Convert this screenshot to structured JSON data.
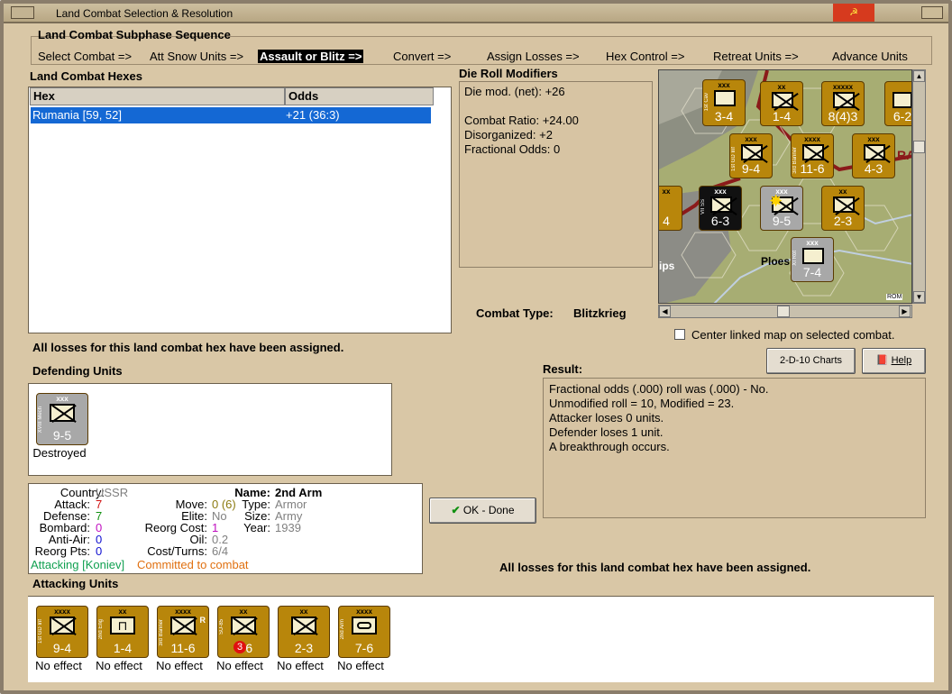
{
  "window": {
    "title": "Land Combat Selection & Resolution"
  },
  "sequence": {
    "heading": "Land Combat Subphase Sequence",
    "steps": [
      "Select Combat =>",
      "Att Snow Units =>",
      "Assault or Blitz =>",
      "Convert =>",
      "Assign Losses =>",
      "Hex Control =>",
      "Retreat Units =>",
      "Advance Units"
    ],
    "active_index": 2
  },
  "hexes": {
    "heading": "Land Combat Hexes",
    "columns": [
      "Hex",
      "Odds"
    ],
    "rows": [
      {
        "hex": "Rumania [59, 52]",
        "odds": "+21 (36:3)"
      }
    ]
  },
  "die_roll": {
    "heading": "Die Roll Modifiers",
    "lines": [
      "Die mod. (net): +26",
      "",
      "Combat Ratio: +24.00",
      "Disorganized: +2",
      "Fractional Odds: 0"
    ]
  },
  "combat_type": {
    "label": "Combat Type:",
    "value": "Blitzkrieg"
  },
  "center_map": {
    "label": "Center linked map on selected combat.",
    "checked": false
  },
  "buttons": {
    "charts": "2-D-10 Charts",
    "help": "Help",
    "ok": "OK - Done"
  },
  "losses_msg": "All losses for this land combat hex have been assigned.",
  "defending": {
    "heading": "Defending Units",
    "units": [
      {
        "size": "xxx",
        "side": "XVIII Mech",
        "value": "9-5",
        "status": "Destroyed",
        "color": "grey"
      }
    ]
  },
  "info": {
    "country_label": "Country:",
    "country": "USSR",
    "attack_label": "Attack:",
    "attack": "7",
    "defense_label": "Defense:",
    "defense": "7",
    "bombard_label": "Bombard:",
    "bombard": "0",
    "antiair_label": "Anti-Air:",
    "antiair": "0",
    "reorgpts_label": "Reorg Pts:",
    "reorgpts": "0",
    "name_label": "Name:",
    "name": "2nd Arm",
    "move_label": "Move:",
    "move": "0 (6)",
    "type_label": "Type:",
    "type": "Armor",
    "elite_label": "Elite:",
    "elite": "No",
    "size_label": "Size:",
    "size": "Army",
    "reorgcost_label": "Reorg Cost:",
    "reorgcost": "1",
    "year_label": "Year:",
    "year": "1939",
    "oil_label": "Oil:",
    "oil": "0.2",
    "costturns_label": "Cost/Turns:",
    "costturns": "6/4",
    "attacking": "Attacking [Koniev]",
    "committed": "Committed to combat"
  },
  "result": {
    "heading": "Result:",
    "lines": [
      "Fractional odds (.000) roll was (.000)  - No.",
      "Unmodified roll = 10, Modified = 23.",
      "Attacker loses 0 units.",
      "Defender loses 1 unit.",
      "A breakthrough occurs."
    ]
  },
  "attacking": {
    "heading": "Attacking Units",
    "units": [
      {
        "size": "xxxx",
        "side": "1st GD Inf",
        "value": "9-4",
        "status": "No effect",
        "symbol": "inf"
      },
      {
        "size": "xx",
        "side": "2nd Eng",
        "value": "1-4",
        "status": "No effect",
        "symbol": "eng"
      },
      {
        "size": "xxxx",
        "side": "3rd Banner",
        "value": "11-6",
        "status": "No effect",
        "symbol": "inf",
        "r": "R"
      },
      {
        "size": "xx",
        "side": "SU-85",
        "value": "3-6",
        "status": "No effect",
        "symbol": "mech",
        "badge": "3"
      },
      {
        "size": "xx",
        "side": "",
        "value": "2-3",
        "status": "No effect",
        "symbol": "inf"
      },
      {
        "size": "xxxx",
        "side": "2nd Arm",
        "value": "7-6",
        "status": "No effect",
        "symbol": "arm"
      }
    ]
  },
  "map": {
    "labels": [
      "Ploes",
      "ips",
      "RA",
      "ROM"
    ],
    "units": [
      {
        "size": "xxx",
        "side": "1st Cav",
        "value": "3-4",
        "color": "gold"
      },
      {
        "size": "xx",
        "side": "",
        "value": "1-4",
        "color": "gold"
      },
      {
        "size": "xxxxx",
        "side": "",
        "value": "8(4)3",
        "color": "gold"
      },
      {
        "size": "",
        "side": "",
        "value": "6-2",
        "color": "gold"
      },
      {
        "size": "xxx",
        "side": "1st GD Inf",
        "value": "9-4",
        "color": "gold"
      },
      {
        "size": "xxxx",
        "side": "3rd Banner",
        "value": "11-6",
        "color": "gold"
      },
      {
        "size": "xxx",
        "side": "",
        "value": "4-3",
        "color": "gold"
      },
      {
        "size": "xxx",
        "side": "VII SS",
        "value": "6-3",
        "color": "black"
      },
      {
        "size": "xxx",
        "side": "",
        "value": "9-5",
        "color": "grey"
      },
      {
        "size": "xx",
        "side": "",
        "value": "2-3",
        "color": "gold"
      },
      {
        "size": "xx",
        "side": "",
        "value": "4",
        "color": "gold"
      },
      {
        "size": "xxx",
        "side": "XI Rot",
        "value": "7-4",
        "color": "grey"
      }
    ]
  }
}
